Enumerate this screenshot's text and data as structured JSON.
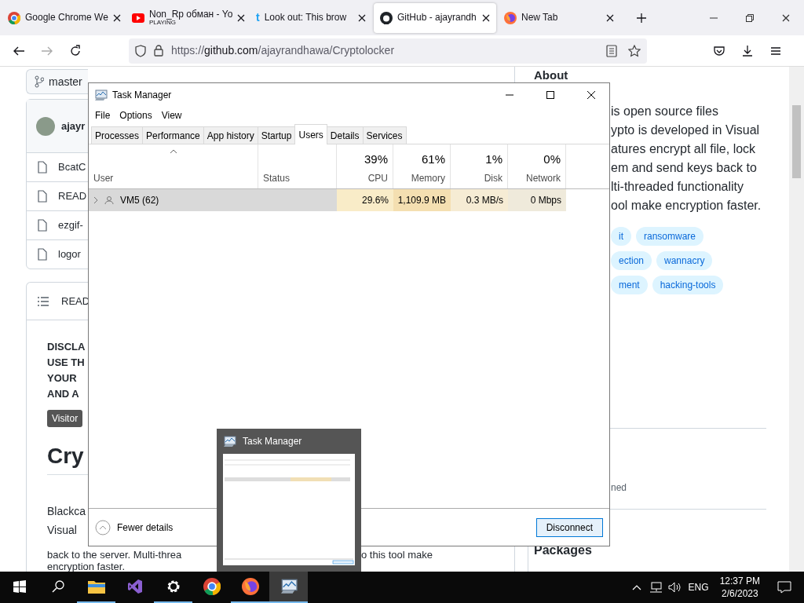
{
  "browser": {
    "tabs": [
      {
        "kind": "chrome",
        "title": "Google Chrome We",
        "selected": false
      },
      {
        "kind": "youtube",
        "title": "Non_Rp обман - Yo",
        "subtitle": "PLAYING",
        "selected": false
      },
      {
        "kind": "letter",
        "glyph": "t",
        "title": "Look out: This brow",
        "selected": false
      },
      {
        "kind": "github",
        "title": "GitHub - ajayrandh",
        "selected": true
      },
      {
        "kind": "firefox",
        "title": "New Tab",
        "selected": false
      }
    ],
    "url": {
      "scheme": "https://",
      "host": "github.com",
      "path": "/ajayrandhawa/Cryptolocker"
    }
  },
  "repo": {
    "branch": "master",
    "about_title": "About",
    "author": "ajayr",
    "files": [
      "BcatC",
      "READ",
      "ezgif-",
      "logor"
    ],
    "readme_title": "READ",
    "disclaimer_lines": [
      "DISCLA",
      "USE TH",
      "YOUR",
      "AND A"
    ],
    "badge": "Visitor",
    "heading": "Cry",
    "readme_lines": [
      "Blackca",
      "Visual"
    ],
    "readme_split_line": [
      "back to the server. Multi-threa",
      "o this tool make"
    ],
    "readme_last": "encryption faster.",
    "about_lines": [
      "is open source files",
      "ypto is developed in Visual",
      "atures encrypt all file, lock",
      "em and send keys back to",
      "lti-threaded functionality",
      "ool make encryption faster."
    ],
    "topics": [
      [
        "it",
        "ransomware"
      ],
      [
        "ection",
        "wannacry"
      ],
      [
        "ment",
        "hacking-tools"
      ]
    ],
    "release_fragment": "ned",
    "packages_title": "Packages"
  },
  "task_manager": {
    "title": "Task Manager",
    "menu": [
      "File",
      "Options",
      "View"
    ],
    "tabs": [
      {
        "label": "Processes",
        "selected": false
      },
      {
        "label": "Performance",
        "selected": false
      },
      {
        "label": "App history",
        "selected": false
      },
      {
        "label": "Startup",
        "selected": false
      },
      {
        "label": "Users",
        "selected": true
      },
      {
        "label": "Details",
        "selected": false
      },
      {
        "label": "Services",
        "selected": false
      }
    ],
    "columns": [
      {
        "label": "User"
      },
      {
        "label": "Status"
      },
      {
        "label": "CPU",
        "total": "39%"
      },
      {
        "label": "Memory",
        "total": "61%"
      },
      {
        "label": "Disk",
        "total": "1%"
      },
      {
        "label": "Network",
        "total": "0%"
      }
    ],
    "rows": [
      {
        "user": "VM5 (62)",
        "expanded": false,
        "selected": true,
        "cpu": "29.6%",
        "memory": "1,109.9 MB",
        "disk": "0.3 MB/s",
        "network": "0 Mbps"
      }
    ],
    "fewer_details": "Fewer details",
    "disconnect": "Disconnect"
  },
  "thumbnail": {
    "title": "Task Manager"
  },
  "taskbar": {
    "apps": [
      {
        "kind": "explorer",
        "running": true,
        "selected": false
      },
      {
        "kind": "studio",
        "running": false,
        "selected": false
      },
      {
        "kind": "settings",
        "running": true,
        "selected": false
      },
      {
        "kind": "chrome",
        "running": false,
        "selected": false
      },
      {
        "kind": "firefox",
        "running": true,
        "selected": false
      },
      {
        "kind": "taskmgr",
        "running": true,
        "selected": true
      }
    ],
    "language": "ENG",
    "time": "12:37 PM",
    "date": "2/6/2023"
  }
}
